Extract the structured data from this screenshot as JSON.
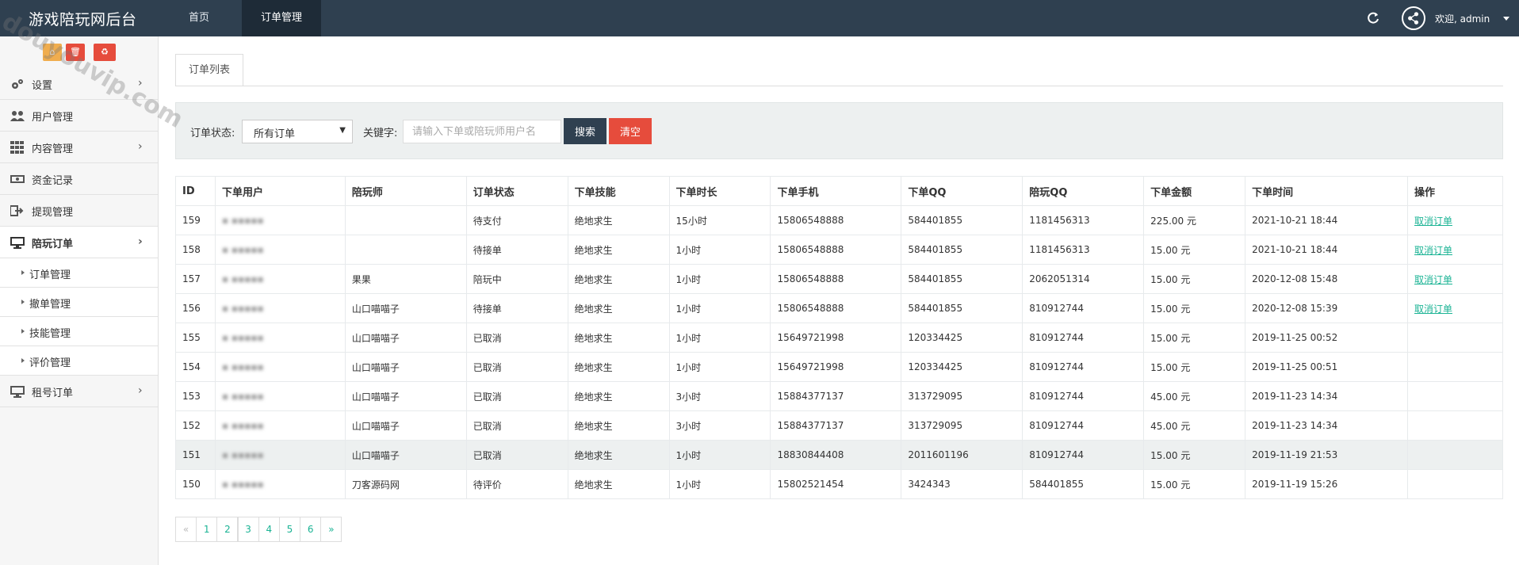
{
  "header": {
    "brand": "游戏陪玩网后台",
    "nav": [
      "首页",
      "订单管理"
    ],
    "welcome": "欢迎, admin"
  },
  "sidebar": {
    "items": [
      {
        "label": "设置",
        "icon": "gears-icon"
      },
      {
        "label": "用户管理",
        "icon": "users-icon"
      },
      {
        "label": "内容管理",
        "icon": "grid-icon"
      },
      {
        "label": "资金记录",
        "icon": "money-icon"
      },
      {
        "label": "提现管理",
        "icon": "sign-out-icon"
      },
      {
        "label": "陪玩订单",
        "icon": "monitor-icon"
      }
    ],
    "sub_items": [
      "订单管理",
      "撤单管理",
      "技能管理",
      "评价管理"
    ],
    "last_item": {
      "label": "租号订单",
      "icon": "monitor-icon"
    }
  },
  "main": {
    "tab": "订单列表",
    "filter": {
      "status_label": "订单状态:",
      "status_value": "所有订单",
      "keyword_label": "关键字:",
      "keyword_placeholder": "请输入下单或陪玩师用户名",
      "search": "搜索",
      "clear": "清空"
    },
    "table": {
      "columns": [
        "ID",
        "下单用户",
        "陪玩师",
        "订单状态",
        "下单技能",
        "下单时长",
        "下单手机",
        "下单QQ",
        "陪玩QQ",
        "下单金额",
        "下单时间",
        "操作"
      ],
      "rows": [
        [
          "159",
          "",
          "",
          "待支付",
          "绝地求生",
          "15小时",
          "15806548888",
          "584401855",
          "1181456313",
          "225.00 元",
          "2021-10-21 18:44",
          "取消订单"
        ],
        [
          "158",
          "",
          "",
          "待接单",
          "绝地求生",
          "1小时",
          "15806548888",
          "584401855",
          "1181456313",
          "15.00 元",
          "2021-10-21 18:44",
          "取消订单"
        ],
        [
          "157",
          "",
          "果果",
          "陪玩中",
          "绝地求生",
          "1小时",
          "15806548888",
          "584401855",
          "2062051314",
          "15.00 元",
          "2020-12-08 15:48",
          "取消订单"
        ],
        [
          "156",
          "",
          "山口喵喵子",
          "待接单",
          "绝地求生",
          "1小时",
          "15806548888",
          "584401855",
          "810912744",
          "15.00 元",
          "2020-12-08 15:39",
          "取消订单"
        ],
        [
          "155",
          "",
          "山口喵喵子",
          "已取消",
          "绝地求生",
          "1小时",
          "15649721998",
          "120334425",
          "810912744",
          "15.00 元",
          "2019-11-25 00:52",
          ""
        ],
        [
          "154",
          "",
          "山口喵喵子",
          "已取消",
          "绝地求生",
          "1小时",
          "15649721998",
          "120334425",
          "810912744",
          "15.00 元",
          "2019-11-25 00:51",
          ""
        ],
        [
          "153",
          "",
          "山口喵喵子",
          "已取消",
          "绝地求生",
          "3小时",
          "15884377137",
          "313729095",
          "810912744",
          "45.00 元",
          "2019-11-23 14:34",
          ""
        ],
        [
          "152",
          "",
          "山口喵喵子",
          "已取消",
          "绝地求生",
          "3小时",
          "15884377137",
          "313729095",
          "810912744",
          "45.00 元",
          "2019-11-23 14:34",
          ""
        ],
        [
          "151",
          "",
          "山口喵喵子",
          "已取消",
          "绝地求生",
          "1小时",
          "18830844408",
          "2011601196",
          "810912744",
          "15.00 元",
          "2019-11-19 21:53",
          ""
        ],
        [
          "150",
          "",
          "刀客源码网",
          "待评价",
          "绝地求生",
          "1小时",
          "15802521454",
          "3424343",
          "584401855",
          "15.00 元",
          "2019-11-19 15:26",
          ""
        ]
      ],
      "highlight_row": 8
    },
    "pagination": [
      "«",
      "1",
      "2",
      "3",
      "4",
      "5",
      "6",
      "»"
    ]
  },
  "watermark": "douyouvip.com"
}
